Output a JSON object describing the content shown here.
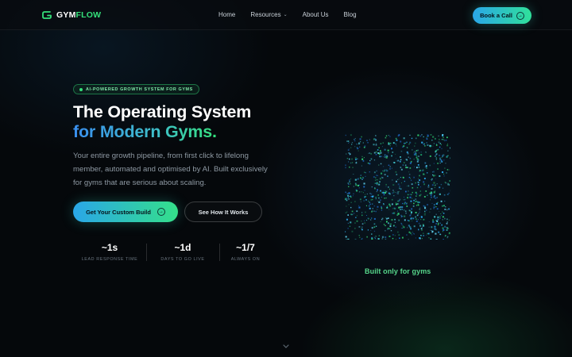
{
  "brand": {
    "name_part1": "GYM",
    "name_part2": "FLOW",
    "accent": "#34e07a"
  },
  "nav": {
    "links": [
      {
        "label": "Home"
      },
      {
        "label": "Resources",
        "has_dropdown": true
      },
      {
        "label": "About Us"
      },
      {
        "label": "Blog"
      }
    ],
    "cta_label": "Book a Call"
  },
  "hero": {
    "badge": "AI-POWERED GROWTH SYSTEM FOR GYMS",
    "title_line1": "The Operating System",
    "title_line2": "for Modern Gyms.",
    "subtitle": "Your entire growth pipeline, from first click to lifelong member, automated and optimised by AI. Built exclusively for gyms that are serious about scaling.",
    "primary_button": "Get Your Custom Build",
    "secondary_button": "See How It Works",
    "stats": [
      {
        "value": "~1s",
        "label": "LEAD RESPONSE TIME"
      },
      {
        "value": "~1d",
        "label": "DAYS TO GO LIVE"
      },
      {
        "value": "~1/7",
        "label": "ALWAYS ON"
      }
    ]
  },
  "visual": {
    "caption": "Built only for gyms"
  },
  "colors": {
    "gradient_start": "#2aa6e8",
    "gradient_end": "#34e08a",
    "background": "#05080b"
  }
}
